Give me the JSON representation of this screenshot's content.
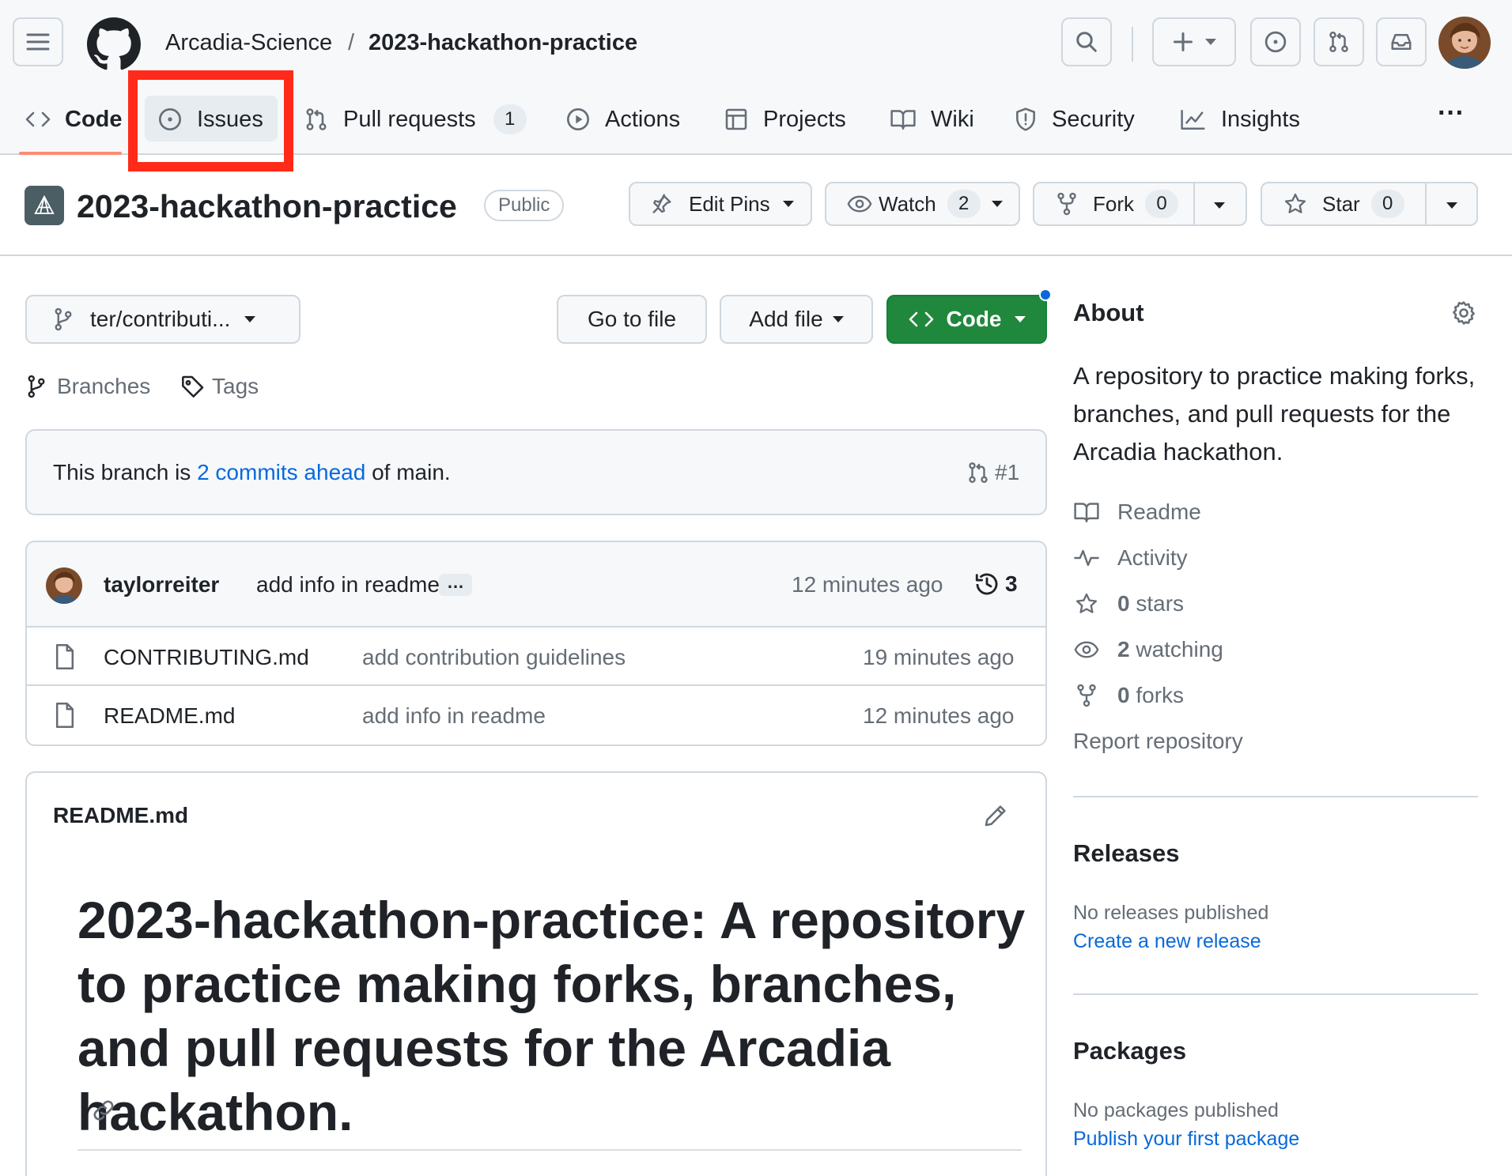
{
  "header": {
    "owner": "Arcadia-Science",
    "separator": "/",
    "repo": "2023-hackathon-practice"
  },
  "tabs": {
    "code": "Code",
    "issues": "Issues",
    "pulls": "Pull requests",
    "pulls_count": "1",
    "actions": "Actions",
    "projects": "Projects",
    "wiki": "Wiki",
    "security": "Security",
    "insights": "Insights",
    "more": "···"
  },
  "repo": {
    "title": "2023-hackathon-practice",
    "visibility": "Public",
    "edit_pins": "Edit Pins",
    "watch": "Watch",
    "watch_count": "2",
    "fork": "Fork",
    "fork_count": "0",
    "star": "Star",
    "star_count": "0"
  },
  "toolbar": {
    "branch": "ter/contributi...",
    "go_to_file": "Go to file",
    "add_file": "Add file",
    "code": "Code",
    "branches": "Branches",
    "tags": "Tags"
  },
  "branch_notice": {
    "prefix": "This branch is ",
    "link": "2 commits ahead",
    "suffix": " of main.",
    "pr": "#1"
  },
  "latest_commit": {
    "author": "taylorreiter",
    "message": "add info in readme",
    "ellipsis": "…",
    "time": "12 minutes ago",
    "count": "3"
  },
  "files": [
    {
      "name": "CONTRIBUTING.md",
      "message": "add contribution guidelines",
      "time": "19 minutes ago"
    },
    {
      "name": "README.md",
      "message": "add info in readme",
      "time": "12 minutes ago"
    }
  ],
  "readme": {
    "filename": "README.md",
    "heading": "2023-hackathon-practice: A repository to practice making forks, branches, and pull requests for the Arcadia hackathon."
  },
  "about": {
    "title": "About",
    "description": "A repository to practice making forks, branches, and pull requests for the Arcadia hackathon.",
    "readme": "Readme",
    "activity": "Activity",
    "stars_count": "0",
    "stars_label": " stars",
    "watching_count": "2",
    "watching_label": " watching",
    "forks_count": "0",
    "forks_label": " forks",
    "report": "Report repository"
  },
  "releases": {
    "title": "Releases",
    "none": "No releases published",
    "create": "Create a new release"
  },
  "packages": {
    "title": "Packages",
    "none": "No packages published",
    "publish": "Publish your first package"
  },
  "colors": {
    "accent_green": "#1f883d",
    "link_blue": "#0969da",
    "highlight_red": "#ff2a1a",
    "tab_underline": "#fd8c73"
  }
}
